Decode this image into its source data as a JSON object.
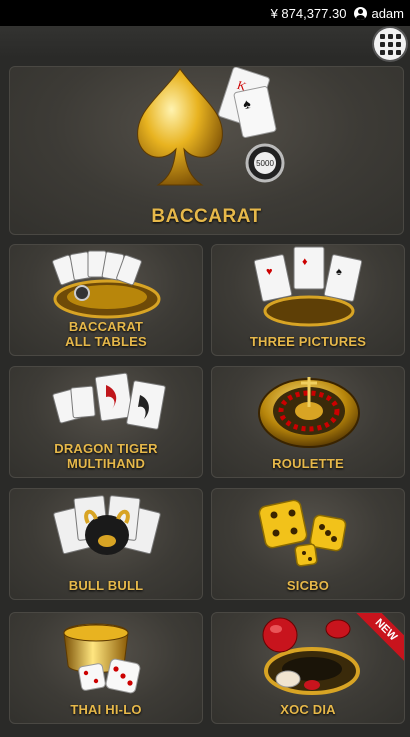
{
  "header": {
    "balance": "¥ 874,377.30",
    "username": "adam"
  },
  "games": {
    "hero": {
      "label": "BACCARAT",
      "chip": "5000"
    },
    "tiles": [
      {
        "line1": "BACCARAT",
        "line2": "ALL TABLES"
      },
      {
        "line1": "THREE PICTURES",
        "line2": ""
      },
      {
        "line1": "DRAGON TIGER",
        "line2": "MULTIHAND"
      },
      {
        "line1": "ROULETTE",
        "line2": ""
      },
      {
        "line1": "BULL BULL",
        "line2": ""
      },
      {
        "line1": "SICBO",
        "line2": ""
      },
      {
        "line1": "THAI HI-LO",
        "line2": ""
      },
      {
        "line1": "XOC DIA",
        "line2": "",
        "badge": "NEW"
      }
    ]
  },
  "colors": {
    "label_gold": "#e6b84a",
    "tile_bg": "#3d3b36",
    "badge_red": "#c8141d"
  }
}
